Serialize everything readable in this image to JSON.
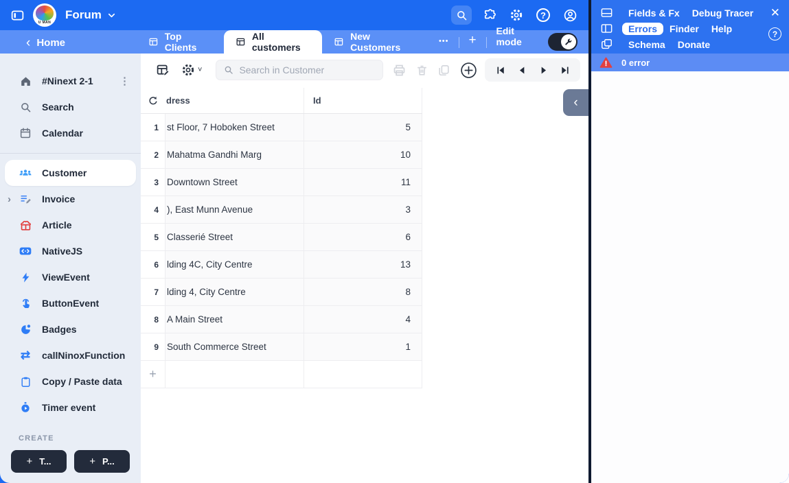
{
  "colors": {
    "topbar_blue": "#1c6af2",
    "tabbar_blue": "#5b90f7",
    "panel_blue": "#2d72f0",
    "errorbar_blue": "#5c8cf4",
    "error_red": "#e34040",
    "sidebar_bg": "#e9eef6",
    "dark_button": "#232b3b",
    "accent_icon_blue": "#2f7df6"
  },
  "icons": {
    "back_chevron": "‹",
    "collapse_chevron": "‹",
    "kebab": "⋮",
    "more": "•••",
    "plus": "+",
    "expander": "›",
    "swap": "⇄",
    "question": "?",
    "close": "✕",
    "gear_chevron": "˅"
  },
  "topbar": {
    "workspace_label": "Forum",
    "logo_text": "U MAN"
  },
  "tabbar": {
    "back_label": "Home",
    "tabs": [
      {
        "label": "Top Clients"
      },
      {
        "label": "All customers"
      },
      {
        "label": "New Customers"
      }
    ],
    "edit_mode_label": "Edit mode"
  },
  "sidebar": {
    "db_name": "#Ninext 2-1",
    "nav_items": [
      {
        "label": "Search"
      },
      {
        "label": "Calendar"
      }
    ],
    "tables": [
      {
        "label": "Customer"
      },
      {
        "label": "Invoice"
      },
      {
        "label": "Article"
      },
      {
        "label": "NativeJS"
      },
      {
        "label": "ViewEvent"
      },
      {
        "label": "ButtonEvent"
      },
      {
        "label": "Badges"
      },
      {
        "label": "callNinoxFunction"
      },
      {
        "label": "Copy / Paste data"
      },
      {
        "label": "Timer event"
      }
    ],
    "create_label": "CREATE",
    "create_buttons": [
      {
        "label": "T..."
      },
      {
        "label": "P..."
      }
    ]
  },
  "toolbar": {
    "search_placeholder": "Search in Customer"
  },
  "grid": {
    "columns": {
      "address": "dress",
      "id": "Id"
    },
    "rows": [
      {
        "n": "1",
        "address": "st Floor, 7 Hoboken Street",
        "id": "5"
      },
      {
        "n": "2",
        "address": "Mahatma Gandhi Marg",
        "id": "10"
      },
      {
        "n": "3",
        "address": "Downtown Street",
        "id": "11"
      },
      {
        "n": "4",
        "address": "), East Munn Avenue",
        "id": "3"
      },
      {
        "n": "5",
        "address": "Classerié Street",
        "id": "6"
      },
      {
        "n": "6",
        "address": "lding 4C, City Centre",
        "id": "13"
      },
      {
        "n": "7",
        "address": "lding 4, City Centre",
        "id": "8"
      },
      {
        "n": "8",
        "address": "A Main Street",
        "id": "4"
      },
      {
        "n": "9",
        "address": "South Commerce Street",
        "id": "1"
      }
    ]
  },
  "debug_panel": {
    "menu_row1": [
      {
        "label": "Fields & Fx"
      },
      {
        "label": "Debug Tracer"
      }
    ],
    "menu_row2": [
      {
        "label": "Errors"
      },
      {
        "label": "Finder"
      },
      {
        "label": "Help"
      }
    ],
    "menu_row3": [
      {
        "label": "Schema"
      },
      {
        "label": "Donate"
      }
    ],
    "error_bar_label": "0 error"
  }
}
